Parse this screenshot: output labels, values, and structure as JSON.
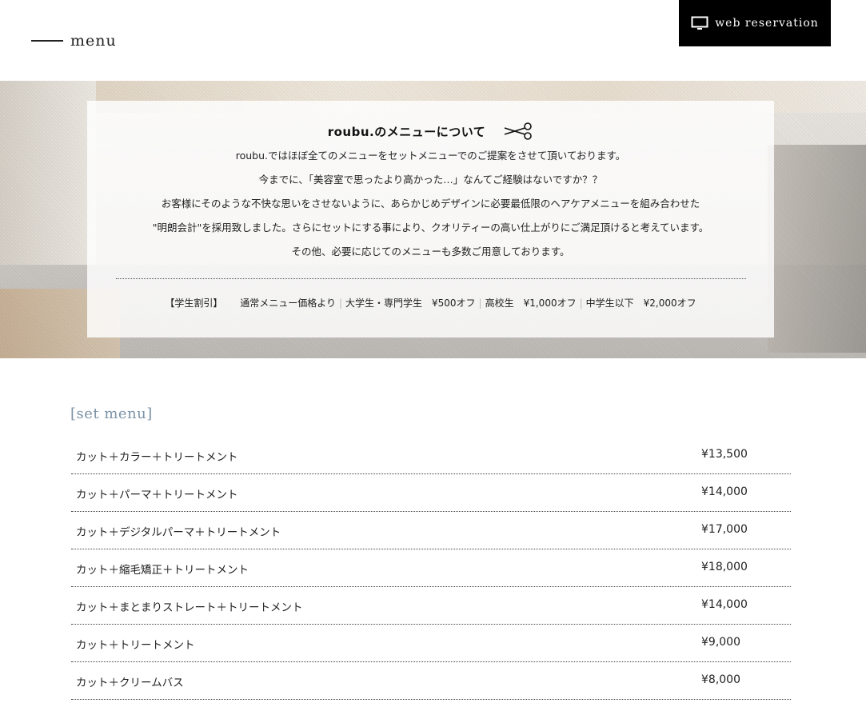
{
  "header": {
    "page_title": "menu",
    "reservation_label": "web reservation",
    "reservation_icon": "monitor-icon"
  },
  "about": {
    "title": "roubu.のメニューについて",
    "title_icon": "scissors-icon",
    "lines": [
      "roubu.ではほぼ全てのメニューをセットメニューでのご提案をさせて頂いております。",
      "今までに、「美容室で思ったより高かった…」なんてご経験はないですか？？",
      "お客様にそのような不快な思いをさせないように、あらかじめデザインに必要最低限のヘアケアメニューを組み合わせた",
      "\"明朗会計\"を採用致しました。さらにセットにする事により、クオリティーの高い仕上がりにご満足頂けると考えています。",
      "その他、必要に応じてのメニューも多数ご用意しております。"
    ],
    "discount": {
      "label": "【学生割引】",
      "intro": "通常メニュー価格より",
      "items": [
        "大学生・専門学生　¥500オフ",
        "高校生　¥1,000オフ",
        "中学生以下　¥2,000オフ"
      ],
      "separator": "|"
    }
  },
  "set_menu": {
    "title": "[set menu]",
    "items": [
      {
        "name": "カット＋カラー＋トリートメント",
        "price": "¥13,500"
      },
      {
        "name": "カット＋パーマ＋トリートメント",
        "price": "¥14,000"
      },
      {
        "name": "カット＋デジタルパーマ＋トリートメント",
        "price": "¥17,000"
      },
      {
        "name": "カット＋縮毛矯正＋トリートメント",
        "price": "¥18,000"
      },
      {
        "name": "カット＋まとまりストレート＋トリートメント",
        "price": "¥14,000"
      },
      {
        "name": "カット＋トリートメント",
        "price": "¥9,000"
      },
      {
        "name": "カット＋クリームバス",
        "price": "¥8,000"
      }
    ]
  },
  "colors": {
    "accent_title": "#7d93a6",
    "button_bg": "#000000",
    "text": "#222222"
  }
}
